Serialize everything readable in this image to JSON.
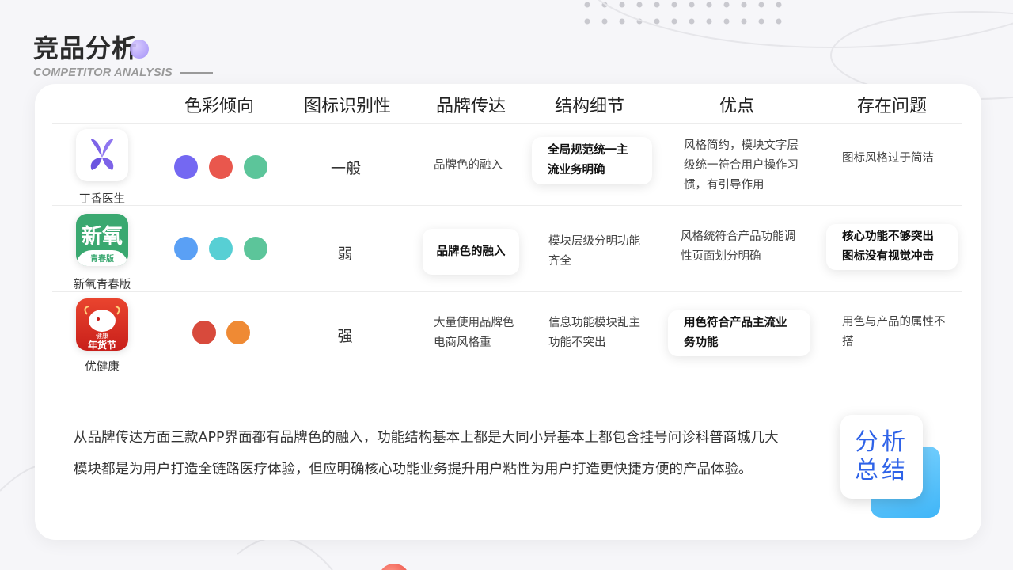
{
  "title": "竞品分析",
  "subtitle": "COMPETITOR ANALYSIS",
  "columns": [
    "色彩倾向",
    "图标识别性",
    "品牌传达",
    "结构细节",
    "优点",
    "存在问题"
  ],
  "rows": [
    {
      "app_name": "丁香医生",
      "icon": "dingxiang-butterfly-icon",
      "colors": [
        "#7468f2",
        "#e9574d",
        "#5cc59a"
      ],
      "recognizability": "一般",
      "brand": "品牌色的融入",
      "structure": "全局规范统一主流业务明确",
      "pros": "风格简约，模块文字层级统一符合用户操作习惯，有引导作用",
      "issues": "图标风格过于简洁"
    },
    {
      "app_name": "新氧青春版",
      "icon": "xinyang-logo-icon",
      "icon_text_main": "新氧",
      "icon_text_sub": "青春版",
      "colors": [
        "#5aa0f5",
        "#57cfd4",
        "#5cc59a"
      ],
      "recognizability": "弱",
      "brand": "品牌色的融入",
      "structure": "模块层级分明功能齐全",
      "pros": "风格统符合产品功能调性页面划分明确",
      "issues": "核心功能不够突出图标没有视觉冲击"
    },
    {
      "app_name": "优健康",
      "icon": "youjiankang-festival-icon",
      "icon_text_small": "健康",
      "icon_text_main": "年货节",
      "colors": [
        "#d84a3c",
        "#ef8a34"
      ],
      "recognizability": "强",
      "brand": "大量使用品牌色电商风格重",
      "structure": "信息功能模块乱主功能不突出",
      "pros": "用色符合产品主流业务功能",
      "issues": "用色与产品的属性不搭"
    }
  ],
  "summary": "从品牌传达方面三款APP界面都有品牌色的融入，功能结构基本上都是大同小异基本上都包含挂号问诊科普商城几大模块都是为用户打造全链路医疗体验，但应明确核心功能业务提升用户粘性为用户打造更快捷方便的产品体验。",
  "badge": {
    "line1": "分析",
    "line2": "总结"
  }
}
